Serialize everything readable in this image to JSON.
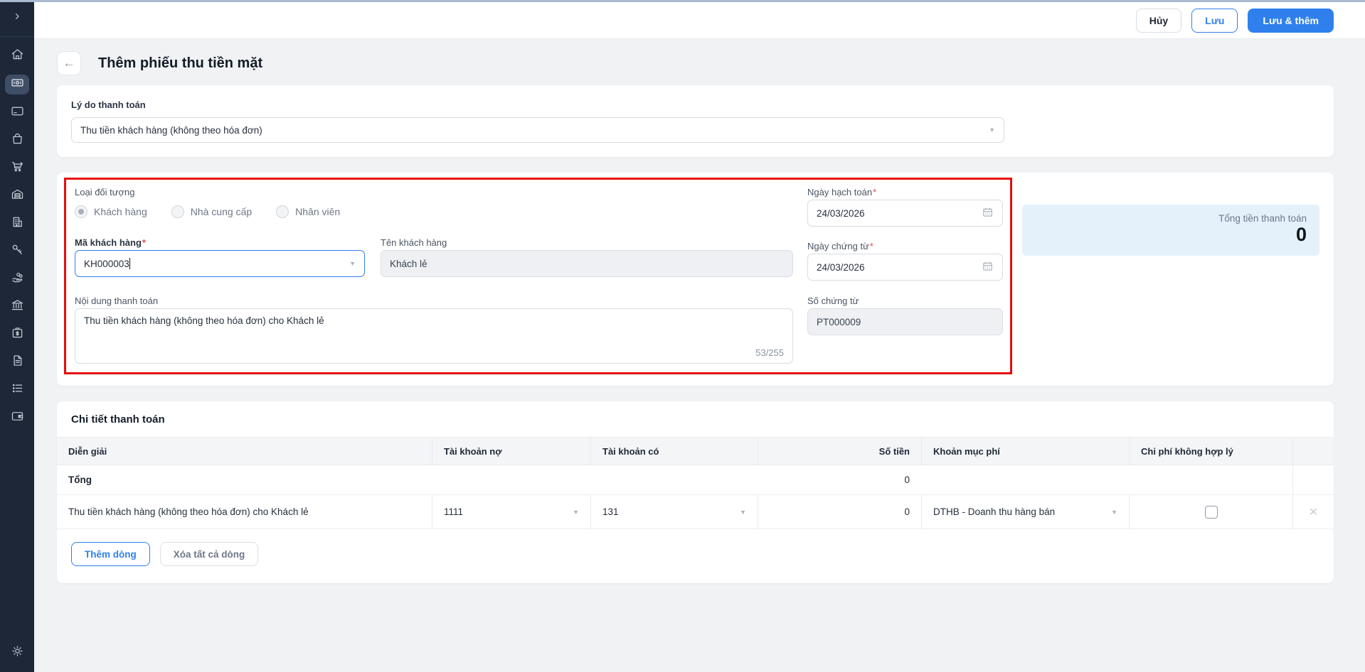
{
  "topbar": {
    "cancel_label": "Hủy",
    "save_label": "Lưu",
    "save_and_add_label": "Lưu & thêm"
  },
  "header": {
    "title": "Thêm phiếu thu tiền mặt"
  },
  "reason": {
    "label": "Lý do thanh toán",
    "value": "Thu tiền khách hàng (không theo hóa đơn)"
  },
  "form": {
    "object_type": {
      "label": "Loại đối tượng",
      "options": [
        {
          "label": "Khách hàng",
          "selected": true
        },
        {
          "label": "Nhà cung cấp",
          "selected": false
        },
        {
          "label": "Nhân viên",
          "selected": false
        }
      ]
    },
    "customer_code": {
      "label": "Mã khách hàng",
      "required": "*",
      "value": "KH000003"
    },
    "customer_name": {
      "label": "Tên khách hàng",
      "value": "Khách lẻ"
    },
    "payment_content": {
      "label": "Nội dung thanh toán",
      "value": "Thu tiền khách hàng (không theo hóa đơn) cho Khách lẻ",
      "counter": "53/255"
    },
    "posting_date": {
      "label": "Ngày hạch toán",
      "required": "*",
      "value": "24/03/2026"
    },
    "document_date": {
      "label": "Ngày chứng từ",
      "required": "*",
      "value": "24/03/2026"
    },
    "document_number": {
      "label": "Số chứng từ",
      "value": "PT000009"
    }
  },
  "summary": {
    "label": "Tổng tiền thanh toán",
    "value": "0"
  },
  "details": {
    "title": "Chi tiết thanh toán",
    "columns": [
      "Diễn giải",
      "Tài khoản nợ",
      "Tài khoản có",
      "Số tiền",
      "Khoản mục phí",
      "Chi phí không hợp lý"
    ],
    "total_row": {
      "label": "Tổng",
      "amount": "0"
    },
    "rows": [
      {
        "description": "Thu tiền khách hàng (không theo hóa đơn) cho Khách lẻ",
        "debit_account": "1111",
        "credit_account": "131",
        "amount": "0",
        "fee_category": "DTHB - Doanh thu hàng bán",
        "invalid_expense_checked": false
      }
    ],
    "add_row_label": "Thêm dòng",
    "delete_all_label": "Xóa tất cả dòng"
  },
  "sidebar": {
    "icons": [
      "collapse-chevron-icon",
      "home-icon",
      "cash-receipt-icon",
      "credit-card-icon",
      "shopping-bag-icon",
      "shopping-cart-icon",
      "warehouse-icon",
      "office-building-icon",
      "key-icon",
      "hand-coins-icon",
      "bank-icon",
      "cash-box-icon",
      "document-icon",
      "list-icon",
      "wallet-icon",
      "settings-gear-icon"
    ]
  },
  "colors": {
    "accent_blue": "#2f80ed",
    "sidebar_bg": "#1d2737",
    "annotation_red": "#e60d0d",
    "summary_bg": "#e4f1fb",
    "required_red": "#e5484d"
  }
}
